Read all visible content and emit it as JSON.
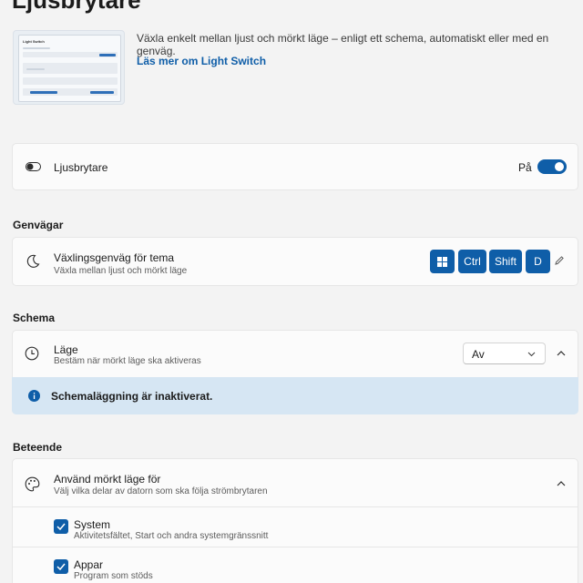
{
  "page": {
    "title": "Ljusbrytare"
  },
  "hero": {
    "description": "Växla enkelt mellan ljust och mörkt läge – enligt ett schema, automatiskt eller med en genväg.",
    "link": "Läs mer om Light Switch",
    "thumb_title": "Light Switch"
  },
  "main_toggle": {
    "label": "Ljusbrytare",
    "state_label": "På",
    "enabled": true
  },
  "shortcuts": {
    "section_label": "Genvägar",
    "title": "Växlingsgenväg för tema",
    "subtitle": "Växla mellan ljust och mörkt läge",
    "keys": [
      "Win",
      "Ctrl",
      "Shift",
      "D"
    ]
  },
  "schedule": {
    "section_label": "Schema",
    "title": "Läge",
    "subtitle": "Bestäm när mörkt läge ska aktiveras",
    "selected": "Av",
    "info": "Schemaläggning är inaktiverat."
  },
  "behavior": {
    "section_label": "Beteende",
    "title": "Använd mörkt läge för",
    "subtitle": "Välj vilka delar av datorn som ska följa strömbrytaren",
    "items": [
      {
        "title": "System",
        "subtitle": "Aktivitetsfältet, Start och andra systemgränssnitt",
        "checked": true
      },
      {
        "title": "Appar",
        "subtitle": "Program som stöds",
        "checked": true
      }
    ]
  },
  "colors": {
    "accent": "#0f5ea8",
    "info_bg": "#d6e6f3",
    "page_bg": "#f3f3f3"
  }
}
